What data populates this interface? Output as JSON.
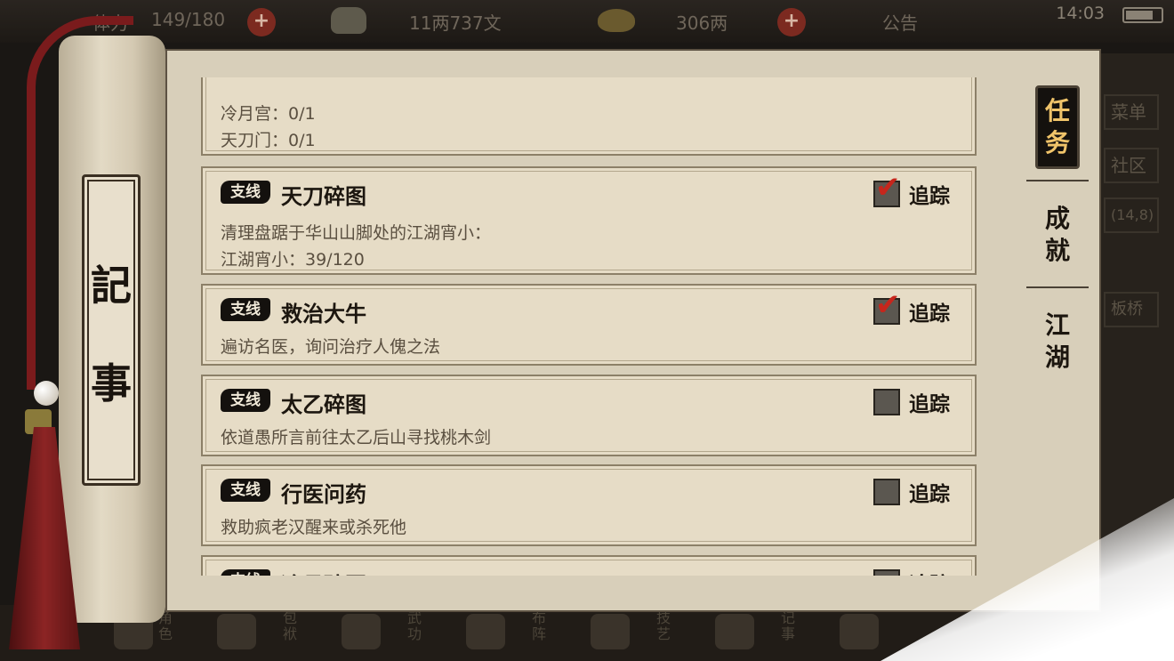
{
  "topbar": {
    "stamina_label": "体力",
    "stamina_value": "149/180",
    "copper": "11两737文",
    "silver": "306两",
    "notice": "公告",
    "time": "14:03"
  },
  "background_right": {
    "menu": "菜单",
    "community": "社区",
    "coords": "(14,8)",
    "place": "板桥"
  },
  "bottom_nav": [
    "角色",
    "包袱",
    "武功",
    "布阵",
    "技艺",
    "记事"
  ],
  "scroll": {
    "title_chars": [
      "記",
      "事"
    ]
  },
  "partial_card": {
    "lines": [
      "冷月宫：0/1",
      "天刀门：0/1"
    ]
  },
  "quests": [
    {
      "tag": "支线",
      "title": "天刀碎图",
      "lines": [
        "清理盘踞于华山山脚处的江湖宵小：",
        "江湖宵小：39/120"
      ],
      "tracked": true,
      "track_label": "追踪"
    },
    {
      "tag": "支线",
      "title": "救治大牛",
      "lines": [
        "遍访名医，询问治疗人傀之法"
      ],
      "tracked": true,
      "track_label": "追踪"
    },
    {
      "tag": "支线",
      "title": "太乙碎图",
      "lines": [
        "依道愚所言前往太乙后山寻找桃木剑"
      ],
      "tracked": false,
      "track_label": "追踪"
    },
    {
      "tag": "支线",
      "title": "行医问药",
      "lines": [
        "救助疯老汉醒来或杀死他"
      ],
      "tracked": false,
      "track_label": "追踪"
    },
    {
      "tag": "支线",
      "title": "冷月碎图",
      "lines": [],
      "tracked": false,
      "track_label": "追踪"
    }
  ],
  "tabs": [
    {
      "label_top": "任",
      "label_bottom": "务",
      "active": true
    },
    {
      "label_top": "成",
      "label_bottom": "就",
      "active": false
    },
    {
      "label_top": "江",
      "label_bottom": "湖",
      "active": false
    }
  ]
}
